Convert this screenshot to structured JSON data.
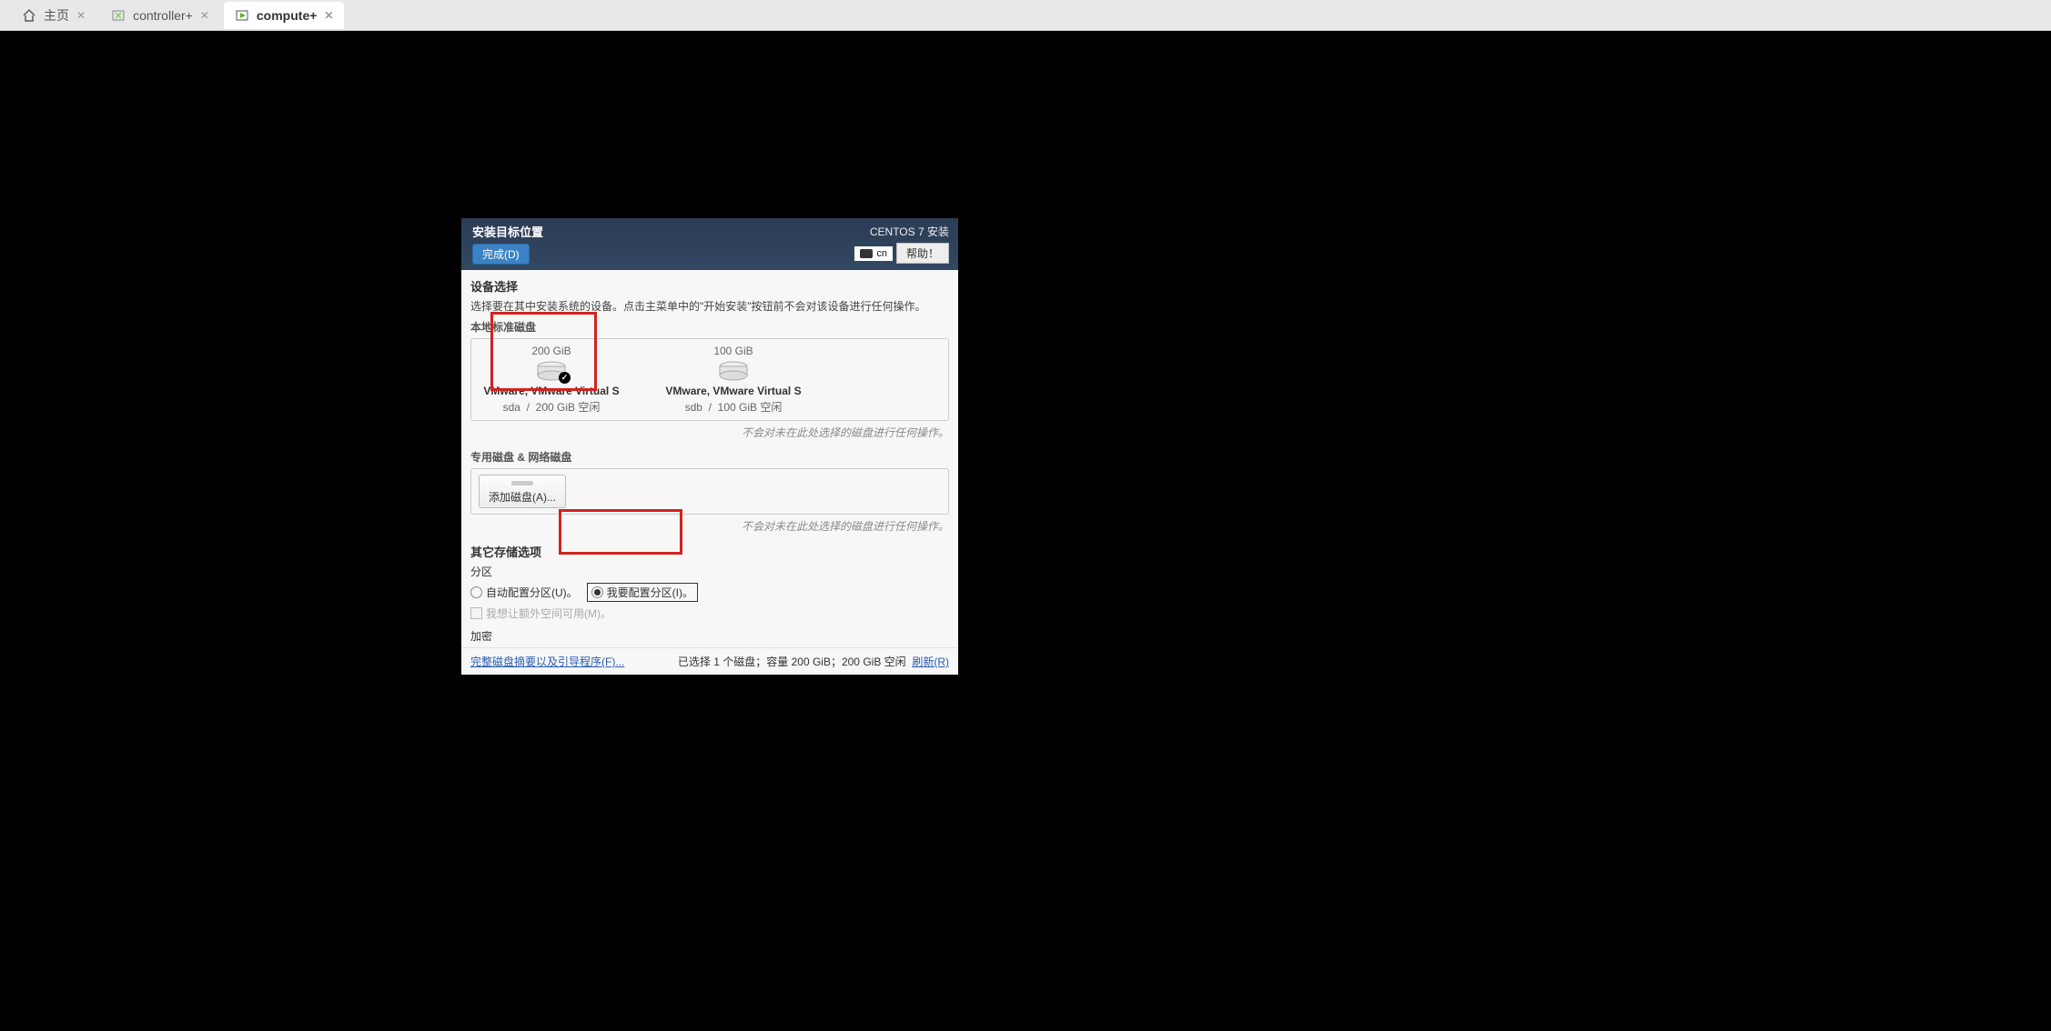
{
  "tabs": [
    {
      "label": "主页"
    },
    {
      "label": "controller+"
    },
    {
      "label": "compute+"
    }
  ],
  "installer": {
    "title": "安装目标位置",
    "done_button": "完成(D)",
    "header_right_title": "CENTOS 7 安装",
    "lang_code": "cn",
    "help_button": "帮助！",
    "device_selection": "设备选择",
    "device_desc": "选择要在其中安装系统的设备。点击主菜单中的\"开始安装\"按钮前不会对该设备进行任何操作。",
    "local_disk_head": "本地标准磁盘",
    "disks": [
      {
        "size": "200 GiB",
        "name": "VMware, VMware Virtual S",
        "dev": "sda",
        "free": "200 GiB 空闲",
        "selected": true
      },
      {
        "size": "100 GiB",
        "name": "VMware, VMware Virtual S",
        "dev": "sdb",
        "free": "100 GiB 空闲",
        "selected": false
      }
    ],
    "note_no_action": "不会对未在此处选择的磁盘进行任何操作。",
    "special_disk_head": "专用磁盘 & 网络磁盘",
    "add_disk_button": "添加磁盘(A)...",
    "other_storage_head": "其它存储选项",
    "partition_head": "分区",
    "radio_auto": "自动配置分区(U)。",
    "radio_manual": "我要配置分区(I)。",
    "checkbox_extra": "我想让额外空间可用(M)。",
    "encryption_head": "加密",
    "footer_link": "完整磁盘摘要以及引导程序(F)...",
    "footer_status": "已选择 1 个磁盘；容量 200 GiB；200 GiB 空闲",
    "footer_refresh": "刷新(R)"
  }
}
